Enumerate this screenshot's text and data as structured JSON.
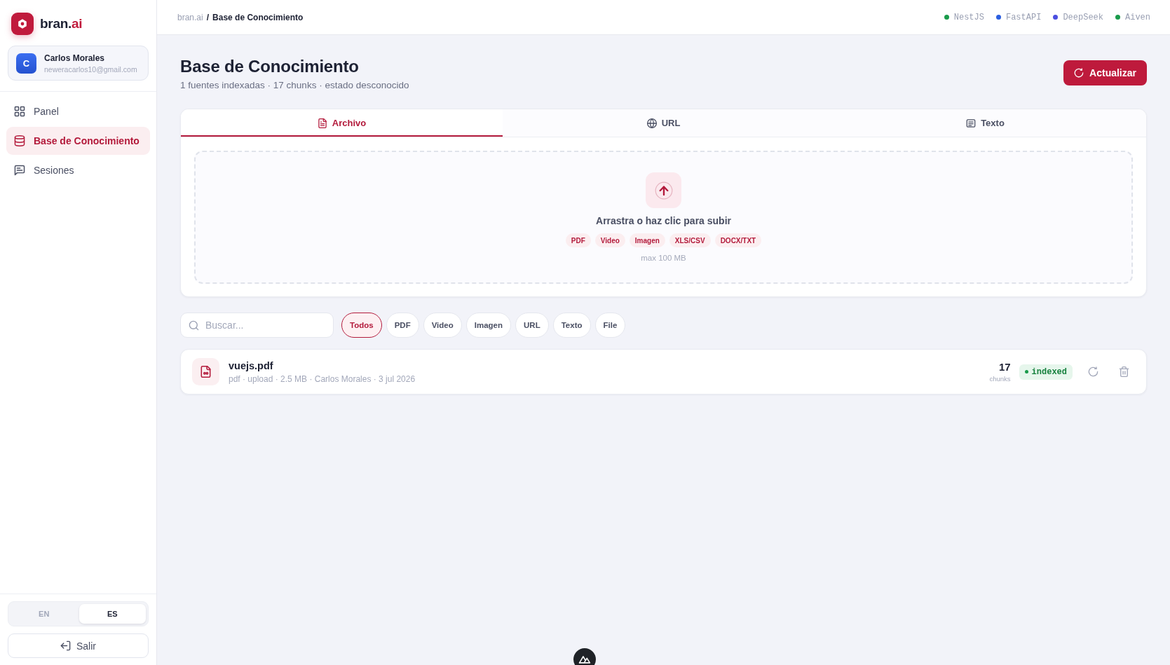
{
  "sidebar": {
    "brand": {
      "name": "bran.",
      "accent": "ai"
    },
    "user": {
      "initial": "C",
      "name": "Carlos Morales",
      "email": "neweracarlos10@gmail.com"
    },
    "nav": [
      {
        "label": "Panel",
        "selected": false
      },
      {
        "label": "Base de Conocimiento",
        "selected": true
      },
      {
        "label": "Sesiones",
        "selected": false
      }
    ],
    "language": [
      {
        "label": "EN",
        "selected": false
      },
      {
        "label": "ES",
        "selected": true
      }
    ],
    "logout_button": "Salir"
  },
  "topbar": {
    "breadcrumb": [
      {
        "label": "bran.ai",
        "current": false
      },
      {
        "label": "Base de Conocimiento",
        "current": true
      }
    ],
    "separator": "/",
    "services": [
      {
        "name": "NestJS",
        "color": "#1a9b4b"
      },
      {
        "name": "FastAPI",
        "color": "#2b5fe0"
      },
      {
        "name": "DeepSeek",
        "color": "#4b4ee0"
      },
      {
        "name": "Aiven",
        "color": "#1a9b4b"
      }
    ]
  },
  "header": {
    "title": "Base de Conocimiento",
    "subtitle": "1 fuentes indexadas · 17 chunks · estado desconocido",
    "refresh_button": "Actualizar"
  },
  "upload": {
    "tabs": [
      {
        "label": "Archivo",
        "selected": true
      },
      {
        "label": "URL",
        "selected": false
      },
      {
        "label": "Texto",
        "selected": false
      }
    ],
    "dropzone": {
      "prompt": "Arrastra o haz clic para subir",
      "formats": [
        "PDF",
        "Video",
        "Imagen",
        "XLS/CSV",
        "DOCX/TXT"
      ],
      "limit": "max 100 MB"
    }
  },
  "filters": {
    "search": {
      "placeholder": "Buscar..."
    },
    "chips": [
      {
        "label": "Todos",
        "selected": true
      },
      {
        "label": "PDF",
        "selected": false
      },
      {
        "label": "Video",
        "selected": false
      },
      {
        "label": "Imagen",
        "selected": false
      },
      {
        "label": "URL",
        "selected": false
      },
      {
        "label": "Texto",
        "selected": false
      },
      {
        "label": "File",
        "selected": false
      }
    ]
  },
  "sources": [
    {
      "name": "vuejs.pdf",
      "meta": "pdf · upload · 2.5 MB · Carlos Morales · 3 jul 2026",
      "chunks": "17",
      "chunks_label": "chunks",
      "status": "indexed"
    }
  ]
}
